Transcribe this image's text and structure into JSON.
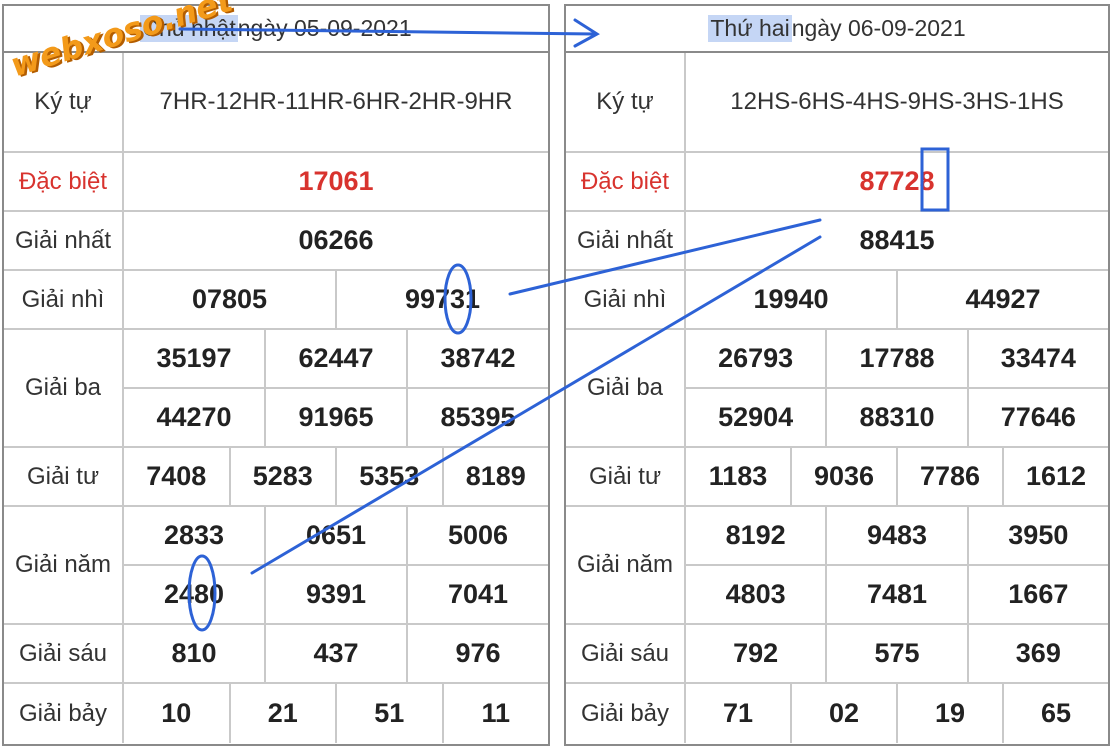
{
  "watermark": "webxoso.net",
  "left": {
    "header": {
      "day": "Chủ nhật",
      "rest": " ngày 05-09-2021"
    },
    "code_label": "Ký tự",
    "code": "7HR-12HR-11HR-6HR-2HR-9HR",
    "prizes": [
      {
        "label": "Đặc biệt",
        "special": true,
        "rows": [
          [
            "17061"
          ]
        ]
      },
      {
        "label": "Giải nhất",
        "rows": [
          [
            "06266"
          ]
        ]
      },
      {
        "label": "Giải nhì",
        "rows": [
          [
            "07805",
            "99731"
          ]
        ]
      },
      {
        "label": "Giải ba",
        "rows": [
          [
            "35197",
            "62447",
            "38742"
          ],
          [
            "44270",
            "91965",
            "85395"
          ]
        ]
      },
      {
        "label": "Giải tư",
        "rows": [
          [
            "7408",
            "5283",
            "5353",
            "8189"
          ]
        ]
      },
      {
        "label": "Giải năm",
        "rows": [
          [
            "2833",
            "0651",
            "5006"
          ],
          [
            "2480",
            "9391",
            "7041"
          ]
        ]
      },
      {
        "label": "Giải sáu",
        "rows": [
          [
            "810",
            "437",
            "976"
          ]
        ]
      },
      {
        "label": "Giải bảy",
        "rows": [
          [
            "10",
            "21",
            "51",
            "11"
          ]
        ]
      }
    ]
  },
  "right": {
    "header": {
      "day": "Thứ hai",
      "rest": " ngày 06-09-2021"
    },
    "code_label": "Ký tự",
    "code": "12HS-6HS-4HS-9HS-3HS-1HS",
    "prizes": [
      {
        "label": "Đặc biệt",
        "special": true,
        "rows": [
          [
            "87728"
          ]
        ]
      },
      {
        "label": "Giải nhất",
        "rows": [
          [
            "88415"
          ]
        ]
      },
      {
        "label": "Giải nhì",
        "rows": [
          [
            "19940",
            "44927"
          ]
        ]
      },
      {
        "label": "Giải ba",
        "rows": [
          [
            "26793",
            "17788",
            "33474"
          ],
          [
            "52904",
            "88310",
            "77646"
          ]
        ]
      },
      {
        "label": "Giải tư",
        "rows": [
          [
            "1183",
            "9036",
            "7786",
            "1612"
          ]
        ]
      },
      {
        "label": "Giải năm",
        "rows": [
          [
            "8192",
            "9483",
            "3950"
          ],
          [
            "4803",
            "7481",
            "1667"
          ]
        ]
      },
      {
        "label": "Giải sáu",
        "rows": [
          [
            "792",
            "575",
            "369"
          ]
        ]
      },
      {
        "label": "Giải bảy",
        "rows": [
          [
            "71",
            "02",
            "19",
            "65"
          ]
        ]
      }
    ]
  },
  "annotation_color": "#2d62d6"
}
